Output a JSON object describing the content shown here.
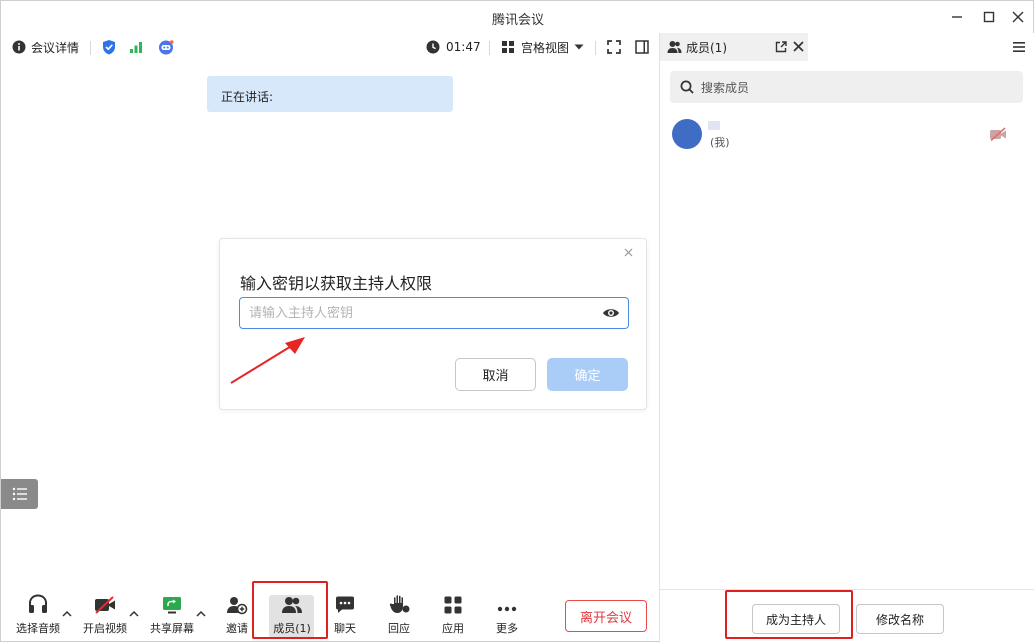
{
  "window": {
    "title": "腾讯会议"
  },
  "topbar": {
    "meeting_details": "会议详情",
    "timer": "01:47",
    "view_mode": "宫格视图"
  },
  "main": {
    "speaking_label": "正在讲话:"
  },
  "dialog": {
    "title": "输入密钥以获取主持人权限",
    "input_value": "",
    "input_placeholder": "请输入主持人密钥",
    "cancel_label": "取消",
    "confirm_label": "确定"
  },
  "bottombar": {
    "audio": "选择音频",
    "video": "开启视频",
    "share": "共享屏幕",
    "invite": "邀请",
    "members": "成员(1)",
    "chat": "聊天",
    "react": "回应",
    "apps": "应用",
    "more": "更多",
    "leave": "离开会议"
  },
  "panel": {
    "tab_label": "成员(1)",
    "search_placeholder": "搜索成员",
    "member_self_tag": "(我)",
    "become_host": "成为主持人",
    "rename": "修改名称"
  },
  "colors": {
    "accent": "#3f6cc4",
    "speaking_bg": "#d8e8fb",
    "danger": "#e0393e",
    "annotation_red": "#e02020",
    "confirm_disabled": "#a9cdf7"
  },
  "icons": [
    "info-icon",
    "shield-icon",
    "signal-icon",
    "bot-icon",
    "clock-icon",
    "grid-icon",
    "caret-down-icon",
    "fullscreen-icon",
    "sidebar-icon",
    "minimize-icon",
    "maximize-icon",
    "close-icon",
    "eye-icon",
    "list-icon",
    "headset-icon",
    "video-off-icon",
    "share-screen-icon",
    "invite-icon",
    "members-icon",
    "chat-icon",
    "hand-icon",
    "apps-icon",
    "more-icon",
    "popout-icon",
    "menu-icon",
    "search-icon",
    "camera-off-icon"
  ]
}
